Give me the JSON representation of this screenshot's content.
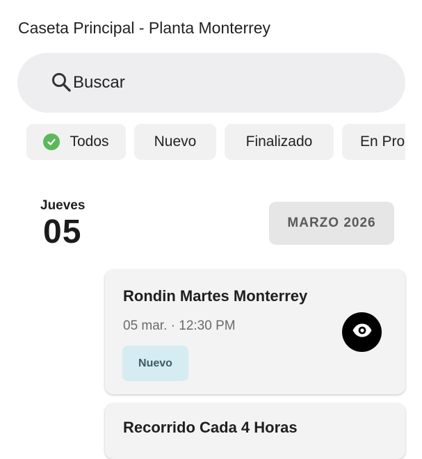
{
  "header": {
    "title": "Caseta Principal - Planta Monterrey"
  },
  "search": {
    "placeholder": "Buscar",
    "icon": "search-icon"
  },
  "filters": {
    "chips": [
      {
        "label": "Todos",
        "selected": true,
        "icon": "check-circle-icon"
      },
      {
        "label": "Nuevo",
        "selected": false
      },
      {
        "label": "Finalizado",
        "selected": false
      },
      {
        "label": "En Pro",
        "selected": false
      }
    ]
  },
  "date_group": {
    "weekday": "Jueves",
    "day": "05",
    "month_label": "MARZO 2026"
  },
  "rounds": [
    {
      "title": "Rondin Martes Monterrey",
      "datetime": "05 mar. · 12:30 PM",
      "status": "Nuevo",
      "action_icon": "eye-icon"
    },
    {
      "title": "Recorrido Cada 4 Horas"
    }
  ],
  "colors": {
    "check_green": "#5cb85c",
    "status_badge_bg": "#d6ecf3",
    "view_button_bg": "#000000"
  }
}
